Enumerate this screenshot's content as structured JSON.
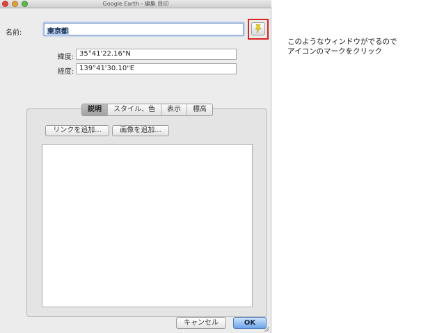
{
  "window": {
    "title": "Google Earth - 編集 目印"
  },
  "form": {
    "name_label": "名前:",
    "name_value": "東京都",
    "latitude_label": "緯度:",
    "latitude_value": "35°41'22.16\"N",
    "longitude_label": "経度:",
    "longitude_value": "139°41'30.10\"E"
  },
  "tabs": [
    {
      "label": "説明",
      "active": true
    },
    {
      "label": "スタイル、色",
      "active": false
    },
    {
      "label": "表示",
      "active": false
    },
    {
      "label": "標高",
      "active": false
    }
  ],
  "description": {
    "add_link_label": "リンクを追加...",
    "add_image_label": "画像を追加..."
  },
  "footer": {
    "cancel_label": "キャンセル",
    "ok_label": "OK"
  },
  "annotation": {
    "line1": "このようなウィンドウがでるので",
    "line2": "アイコンのマークをクリック"
  },
  "icons": {
    "placemark": "pushpin-icon",
    "placemark_color": "#e8d21a",
    "highlight_color": "#d9231f"
  }
}
